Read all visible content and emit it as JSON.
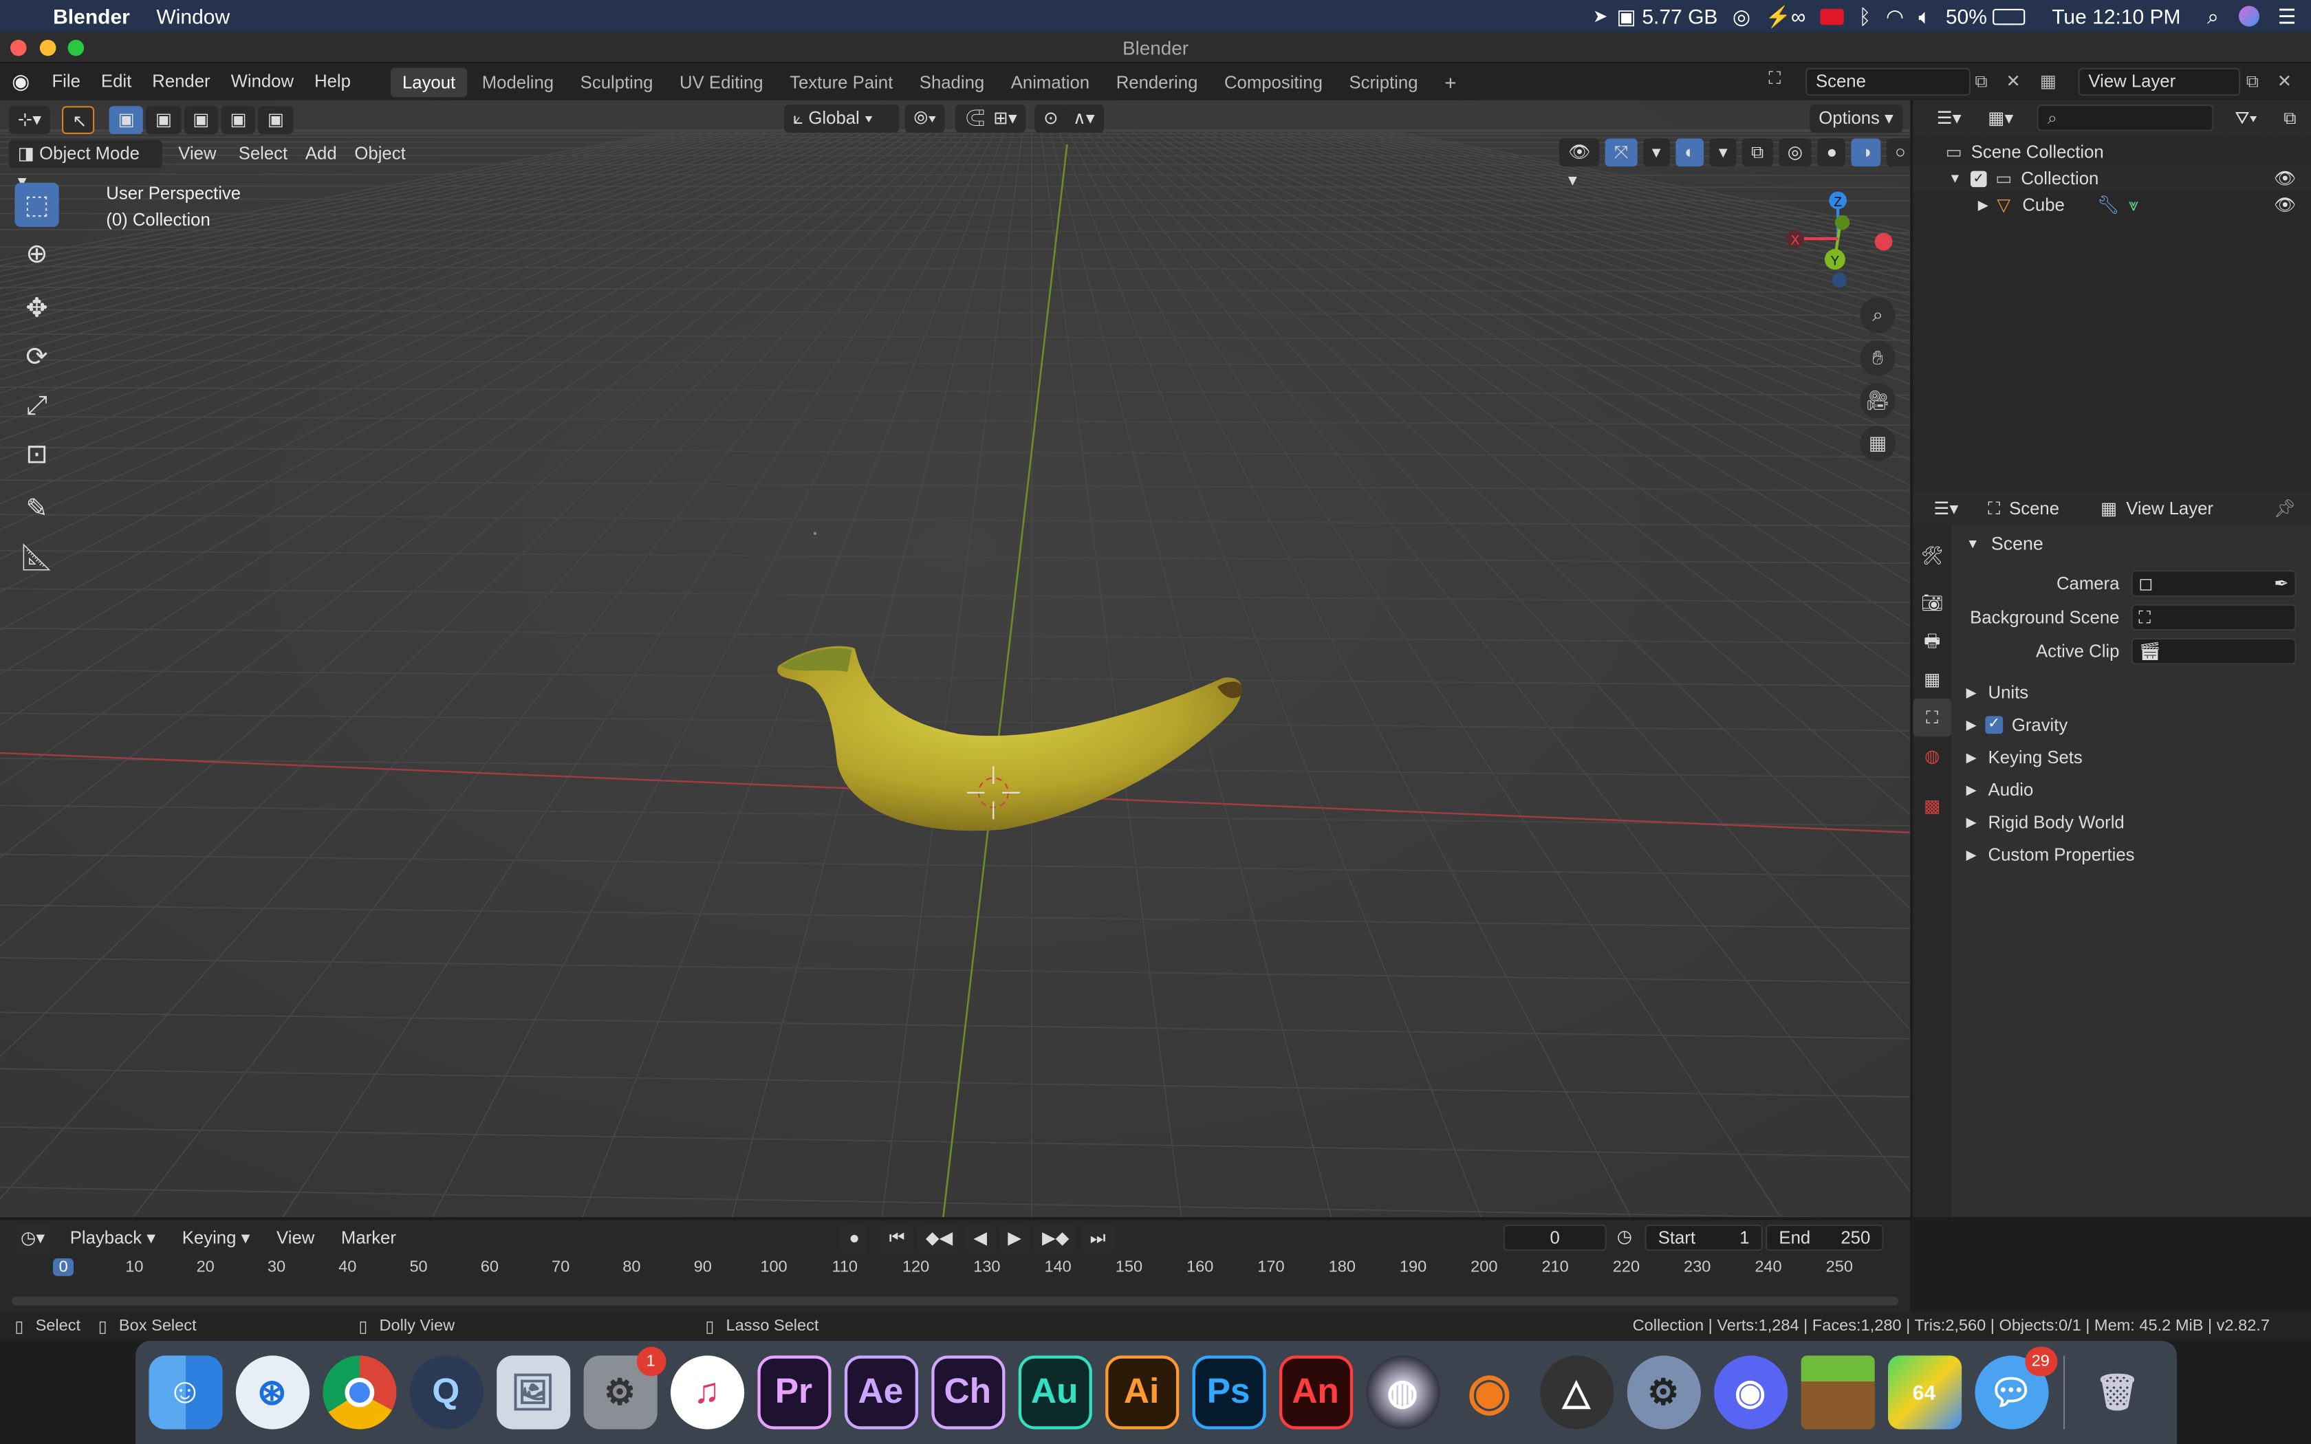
{
  "mac_menubar": {
    "app_name": "Blender",
    "menu": "Window",
    "memory": "5.77 GB",
    "battery": "50%",
    "clock": "Tue 12:10 PM"
  },
  "window": {
    "title": "Blender"
  },
  "topbar": {
    "menus": [
      "File",
      "Edit",
      "Render",
      "Window",
      "Help"
    ],
    "workspaces": [
      "Layout",
      "Modeling",
      "Sculpting",
      "UV Editing",
      "Texture Paint",
      "Shading",
      "Animation",
      "Rendering",
      "Compositing",
      "Scripting"
    ],
    "add_workspace": "+",
    "scene": "Scene",
    "view_layer": "View Layer"
  },
  "viewport": {
    "transform_orientation": "Global",
    "options": "Options",
    "mode": "Object Mode",
    "menus": [
      "View",
      "Select",
      "Add",
      "Object"
    ],
    "overlay_line1": "User Perspective",
    "overlay_line2": "(0) Collection",
    "gizmo": {
      "z": "Z",
      "y": "Y",
      "x": "X"
    }
  },
  "outliner": {
    "scene_collection": "Scene Collection",
    "collection": "Collection",
    "cube": "Cube"
  },
  "properties": {
    "tab_scene": "Scene",
    "tab_view_layer": "View Layer",
    "section": "Scene",
    "camera_label": "Camera",
    "background_scene_label": "Background Scene",
    "active_clip_label": "Active Clip",
    "panels": [
      "Units",
      "Gravity",
      "Keying Sets",
      "Audio",
      "Rigid Body World",
      "Custom Properties"
    ]
  },
  "timeline": {
    "menus": [
      "Playback",
      "Keying",
      "View",
      "Marker"
    ],
    "current_frame": "0",
    "start_label": "Start",
    "start_value": "1",
    "end_label": "End",
    "end_value": "250",
    "ticks": [
      "0",
      "10",
      "20",
      "30",
      "40",
      "50",
      "60",
      "70",
      "80",
      "90",
      "100",
      "110",
      "120",
      "130",
      "140",
      "150",
      "160",
      "170",
      "180",
      "190",
      "200",
      "210",
      "220",
      "230",
      "240",
      "250"
    ]
  },
  "statusbar": {
    "select": "Select",
    "box_select": "Box Select",
    "dolly_view": "Dolly View",
    "lasso_select": "Lasso Select",
    "stats": "Collection | Verts:1,284 | Faces:1,280 | Tris:2,560 | Objects:0/1 | Mem: 45.2 MiB | v2.82.7"
  },
  "dock": {
    "apps": [
      "Finder",
      "Safari",
      "Chrome",
      "QuickTime",
      "Preview",
      "System Preferences",
      "iTunes",
      "Pr",
      "Ae",
      "Ch",
      "Au",
      "Ai",
      "Ps",
      "An",
      "Cinema 4D",
      "Blender",
      "Unity",
      "Discord",
      "Minecraft",
      "BlueStacks",
      "Messages",
      "Trash"
    ],
    "badge_system_prefs": "1",
    "badge_messages": "29"
  },
  "colors": {
    "accent": "#4772b3",
    "x_axis": "#e5404f",
    "y_axis": "#7fb81f",
    "z_axis": "#2e88e6"
  }
}
